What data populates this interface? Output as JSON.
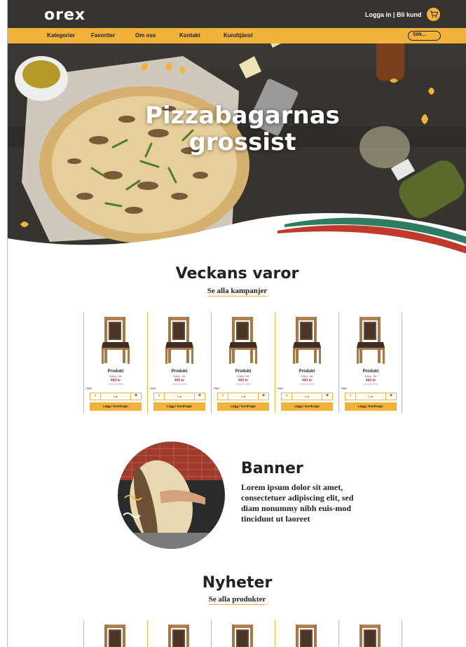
{
  "header": {
    "logo": "orex",
    "login_label": "Logga in | Bli kund",
    "cart_icon": "cart-icon"
  },
  "nav": {
    "items": [
      "Kategorier",
      "Favoriter",
      "Om oss",
      "Kontakt",
      "Kundtjänst"
    ],
    "search_placeholder": "Sök..."
  },
  "hero": {
    "title_line1": "Pizzabagarnas",
    "title_line2": "grossist"
  },
  "weekly": {
    "title": "Veckans varor",
    "link": "Se alla kampanjer",
    "products": [
      {
        "name": "Produkt",
        "sub": "Märke, vikt",
        "price": "490 kr",
        "compare": "Jmf pris 000kr",
        "stock": "i lager",
        "qty": "1 st",
        "buy": "Lägg i kundvagn"
      },
      {
        "name": "Produkt",
        "sub": "Märke, vikt",
        "price": "490 kr",
        "compare": "Jmf pris 000kr",
        "stock": "i lager",
        "qty": "1 st",
        "buy": "Lägg i kundvagn"
      },
      {
        "name": "Produkt",
        "sub": "Märke, vikt",
        "price": "490 kr",
        "compare": "Jmf pris 000kr",
        "stock": "i lager",
        "qty": "1 st",
        "buy": "Lägg i kundvagn"
      },
      {
        "name": "Produkt",
        "sub": "Märke, vikt",
        "price": "490 kr",
        "compare": "Jmf pris 000kr",
        "stock": "i lager",
        "qty": "1 st",
        "buy": "Lägg i kundvagn"
      },
      {
        "name": "Produkt",
        "sub": "Märke, vikt",
        "price": "490 kr",
        "compare": "Jmf pris 000kr",
        "stock": "i lager",
        "qty": "1 st",
        "buy": "Lägg i kundvagn"
      }
    ],
    "minus": "-",
    "plus": "+"
  },
  "banner": {
    "title": "Banner",
    "text": "Lorem ipsum dolor sit amet, consectetuer adipiscing elit, sed diam nonummy nibh euis-mod tincidunt ut laoreet"
  },
  "news": {
    "title": "Nyheter",
    "link": "Se alla produkter"
  },
  "colors": {
    "accent": "#f2b33d",
    "price": "#c0392b",
    "stripe_green": "#2e7d62",
    "stripe_red": "#c0392b"
  }
}
